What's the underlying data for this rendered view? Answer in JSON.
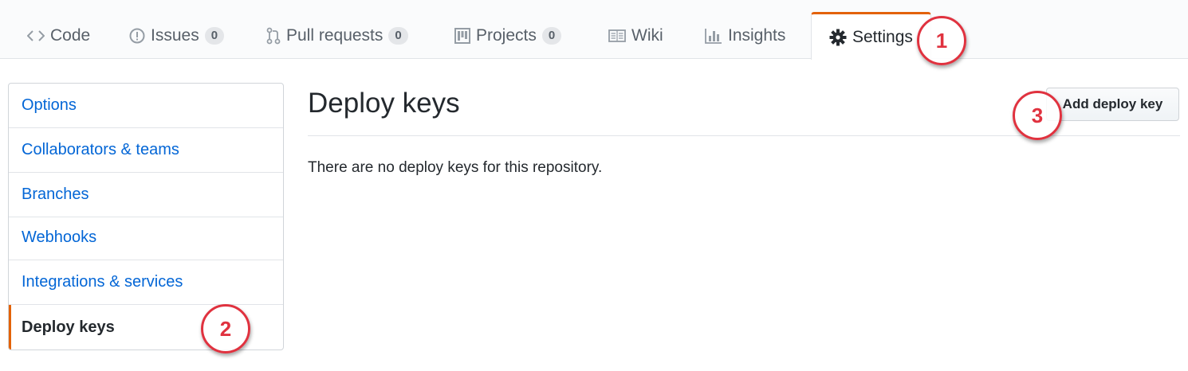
{
  "tabs": [
    {
      "label": "Code",
      "icon": "code-icon"
    },
    {
      "label": "Issues",
      "icon": "issue-icon",
      "count": "0"
    },
    {
      "label": "Pull requests",
      "icon": "pull-request-icon",
      "count": "0"
    },
    {
      "label": "Projects",
      "icon": "project-icon",
      "count": "0"
    },
    {
      "label": "Wiki",
      "icon": "book-icon"
    },
    {
      "label": "Insights",
      "icon": "graph-icon"
    },
    {
      "label": "Settings",
      "icon": "gear-icon",
      "selected": true
    }
  ],
  "menu": {
    "items": [
      {
        "label": "Options"
      },
      {
        "label": "Collaborators & teams"
      },
      {
        "label": "Branches"
      },
      {
        "label": "Webhooks"
      },
      {
        "label": "Integrations & services"
      },
      {
        "label": "Deploy keys",
        "selected": true
      }
    ]
  },
  "main": {
    "title": "Deploy keys",
    "add_button_label": "Add deploy key",
    "empty_message": "There are no deploy keys for this repository."
  },
  "annotations": [
    "1",
    "2",
    "3"
  ],
  "colors": {
    "accent": "#e36209",
    "link": "#0366d6",
    "annotation": "#e0323f"
  }
}
